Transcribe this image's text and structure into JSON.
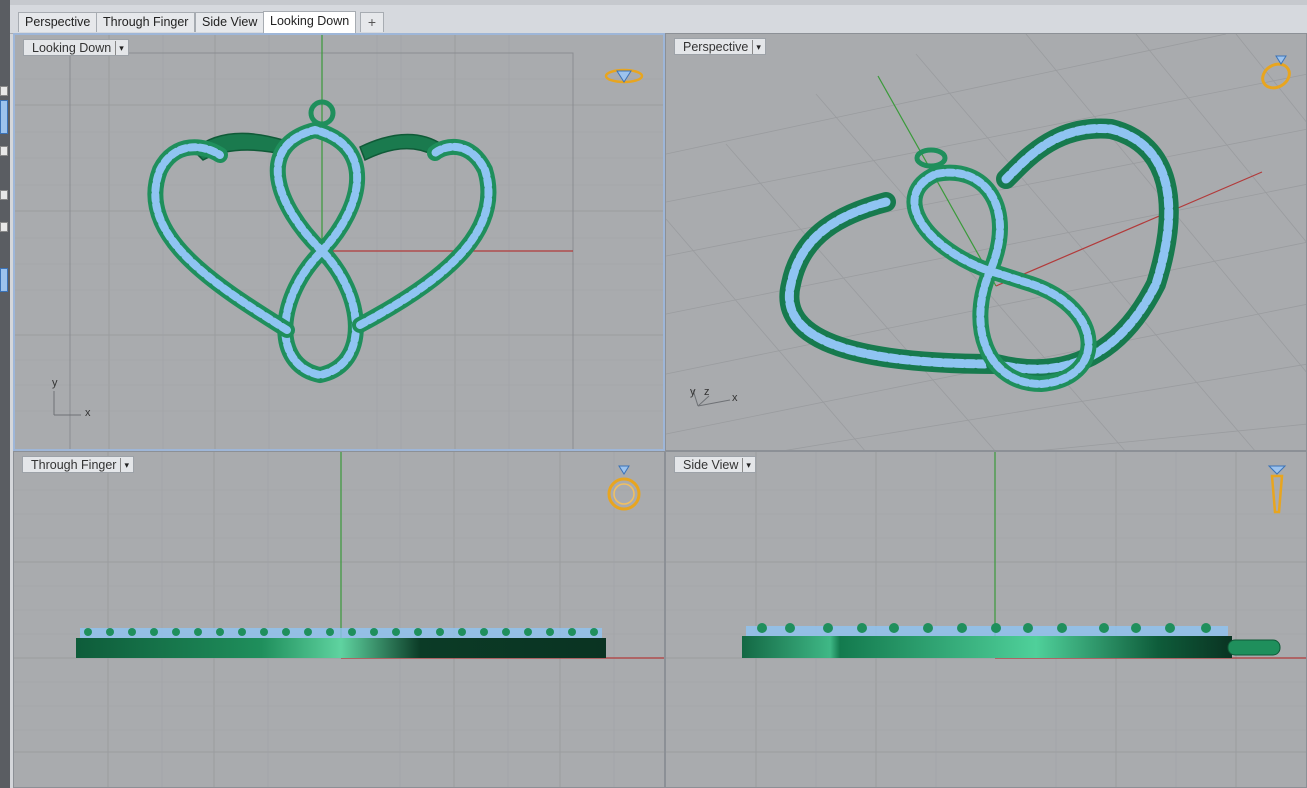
{
  "tabs": [
    {
      "label": "Perspective",
      "active": false
    },
    {
      "label": "Through Finger",
      "active": false
    },
    {
      "label": "Side View",
      "active": false
    },
    {
      "label": "Looking Down",
      "active": true
    }
  ],
  "add_tab_symbol": "+",
  "viewports": {
    "top_left": {
      "label": "Looking Down",
      "dropdown": "▾",
      "axis_x": "x",
      "axis_y": "y",
      "icon": "ring-top-icon"
    },
    "top_right": {
      "label": "Perspective",
      "dropdown": "▾",
      "axis_x": "x",
      "axis_y": "y",
      "axis_z": "z",
      "icon": "ring-perspective-icon"
    },
    "bottom_left": {
      "label": "Through Finger",
      "dropdown": "▾",
      "icon": "ring-front-icon"
    },
    "bottom_right": {
      "label": "Side View",
      "dropdown": "▾",
      "icon": "ring-side-icon"
    }
  },
  "colors": {
    "viewport_bg": "#a9abae",
    "grid_minor": "#9c9ea2",
    "grid_major": "#8d9094",
    "metal": "#1f8f5c",
    "stone": "#8fc4f2",
    "x_axis": "#b23a3a",
    "y_axis": "#3a9a3a",
    "icon_gold": "#e8a51f"
  }
}
